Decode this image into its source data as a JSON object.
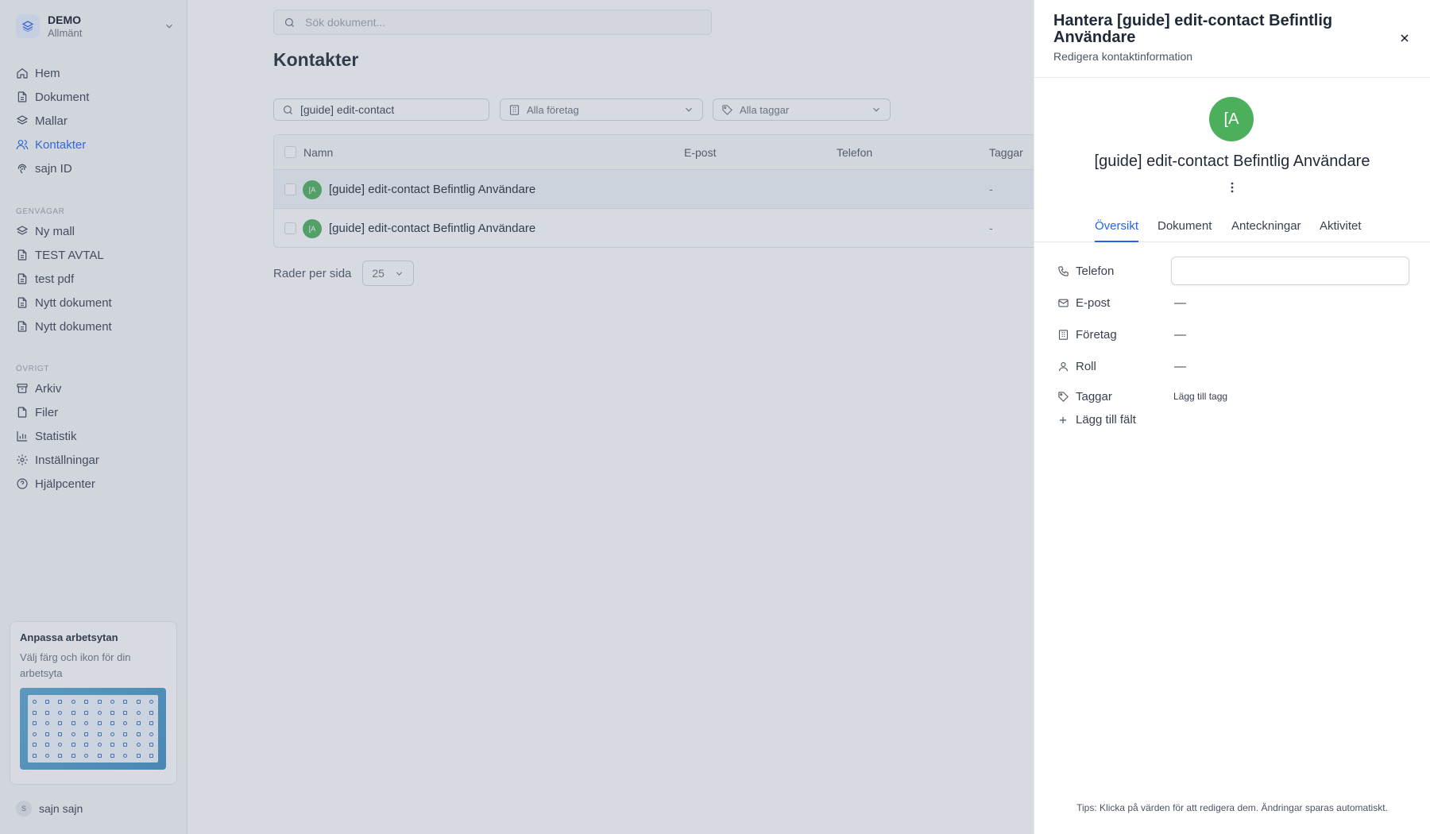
{
  "workspace": {
    "name": "DEMO",
    "subtitle": "Allmänt"
  },
  "nav": [
    {
      "label": "Hem",
      "icon": "home-icon"
    },
    {
      "label": "Dokument",
      "icon": "document-icon"
    },
    {
      "label": "Mallar",
      "icon": "layers-icon"
    },
    {
      "label": "Kontakter",
      "icon": "users-icon",
      "active": true
    },
    {
      "label": "sajn ID",
      "icon": "fingerprint-icon"
    }
  ],
  "shortcuts": {
    "title": "GENVÄGAR",
    "items": [
      {
        "label": "Ny mall",
        "icon": "layers-icon"
      },
      {
        "label": "TEST AVTAL",
        "icon": "document-icon"
      },
      {
        "label": "test pdf",
        "icon": "document-icon"
      },
      {
        "label": "Nytt dokument",
        "icon": "document-icon"
      },
      {
        "label": "Nytt dokument",
        "icon": "document-icon"
      }
    ]
  },
  "other": {
    "title": "ÖVRIGT",
    "items": [
      {
        "label": "Arkiv",
        "icon": "archive-icon"
      },
      {
        "label": "Filer",
        "icon": "file-icon"
      },
      {
        "label": "Statistik",
        "icon": "chart-icon"
      },
      {
        "label": "Inställningar",
        "icon": "gear-icon"
      },
      {
        "label": "Hjälpcenter",
        "icon": "help-icon"
      }
    ]
  },
  "promo": {
    "title": "Anpassa arbetsytan",
    "description": "Välj färg och ikon för din arbetsyta"
  },
  "user": {
    "initial": "S",
    "name": "sajn sajn"
  },
  "search": {
    "placeholder": "Sök dokument..."
  },
  "page": {
    "title": "Kontakter"
  },
  "filters": {
    "search_value": "[guide] edit-contact",
    "company": "Alla företag",
    "tags": "Alla taggar"
  },
  "table": {
    "columns": [
      "Namn",
      "E-post",
      "Telefon",
      "Taggar"
    ],
    "rows": [
      {
        "initials": "[A",
        "name": "[guide] edit-contact Befintlig Användare",
        "tags": "-"
      },
      {
        "initials": "[A",
        "name": "[guide] edit-contact Befintlig Användare",
        "tags": "-"
      }
    ]
  },
  "pagination": {
    "label": "Rader per sida",
    "value": "25"
  },
  "drawer": {
    "title": "Hantera [guide] edit-contact Befintlig Användare",
    "subtitle": "Redigera kontaktinformation",
    "initials": "[A",
    "name": "[guide] edit-contact Befintlig Användare",
    "tabs": [
      "Översikt",
      "Dokument",
      "Anteckningar",
      "Aktivitet"
    ],
    "active_tab": "Översikt",
    "fields": {
      "phone": {
        "label": "Telefon",
        "value": ""
      },
      "email": {
        "label": "E-post",
        "value": "—"
      },
      "company": {
        "label": "Företag",
        "value": "—"
      },
      "role": {
        "label": "Roll",
        "value": "—"
      },
      "tags": {
        "label": "Taggar",
        "value": "Lägg till tagg"
      }
    },
    "add_field": "Lägg till fält",
    "tip": "Tips: Klicka på värden för att redigera dem. Ändringar sparas automatiskt."
  },
  "colors": {
    "accent": "#2563eb",
    "avatar": "#4caf5c",
    "overlay": "rgba(100,116,139,0.26)"
  }
}
